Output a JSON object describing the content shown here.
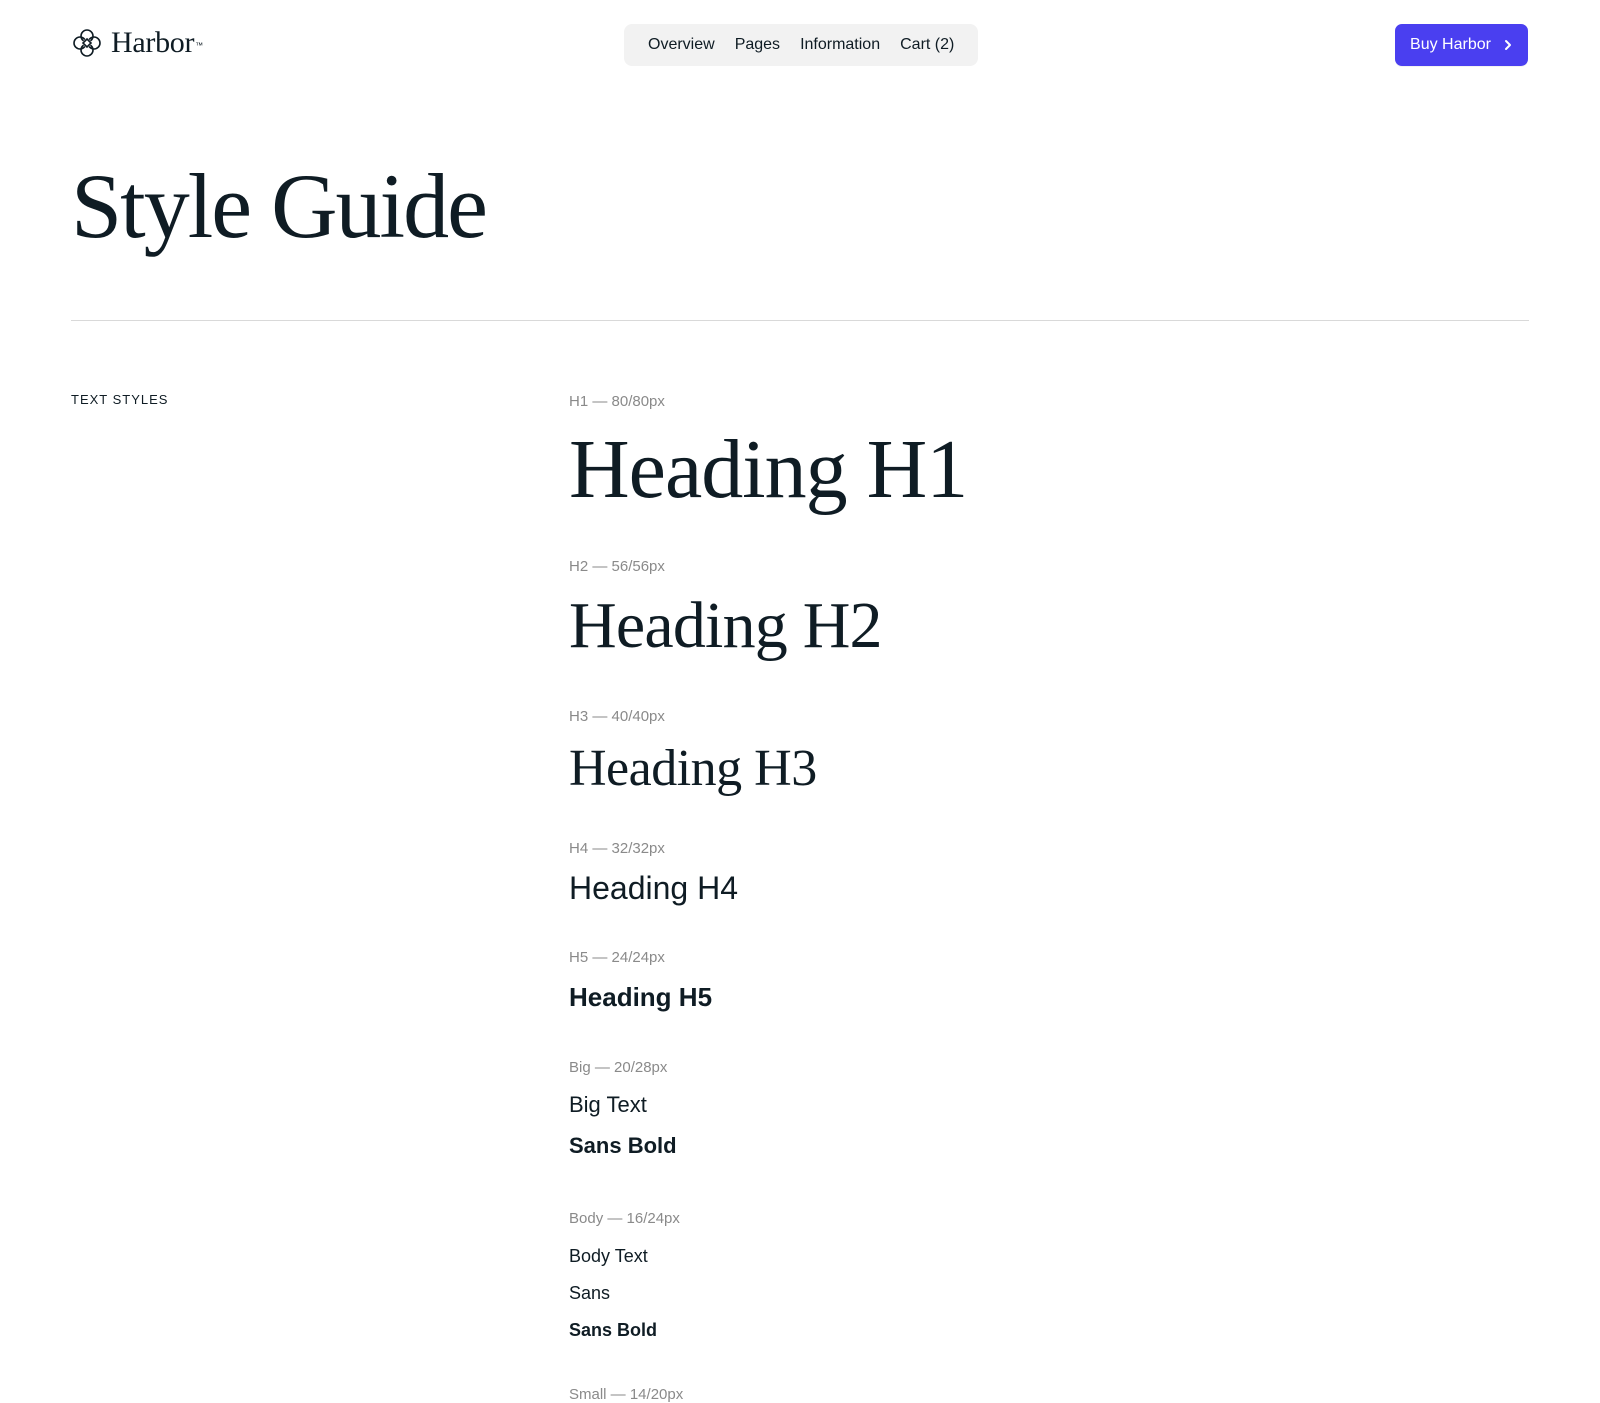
{
  "header": {
    "logo_text": "Harbor",
    "logo_tm": "™",
    "logo_icon": "flower-logo-icon",
    "nav": [
      {
        "label": "Overview"
      },
      {
        "label": "Pages"
      },
      {
        "label": "Information"
      },
      {
        "label": "Cart (2)"
      }
    ],
    "cta": {
      "label": "Buy Harbor",
      "icon": "chevron-right-icon",
      "color": "#4a3ff0"
    }
  },
  "page": {
    "title": "Style Guide",
    "section_label": "TEXT STYLES"
  },
  "text_styles": {
    "h1": {
      "spec": "H1 — 80/80px",
      "sample": "Heading H1"
    },
    "h2": {
      "spec": "H2 — 56/56px",
      "sample": "Heading H2"
    },
    "h3": {
      "spec": "H3 — 40/40px",
      "sample": "Heading H3"
    },
    "h4": {
      "spec": "H4 — 32/32px",
      "sample": "Heading H4"
    },
    "h5": {
      "spec": "H5 — 24/24px",
      "sample": "Heading H5"
    },
    "big": {
      "spec": "Big — 20/28px",
      "samples": [
        "Big Text",
        "Sans Bold"
      ]
    },
    "body": {
      "spec": "Body — 16/24px",
      "samples": [
        "Body Text",
        "Sans",
        "Sans Bold"
      ]
    },
    "small": {
      "spec": "Small — 14/20px"
    }
  },
  "colors": {
    "text": "#0f1c24",
    "muted": "#8a8a8a",
    "nav_bg": "#f2f2f2",
    "divider": "#d9d9d9"
  }
}
